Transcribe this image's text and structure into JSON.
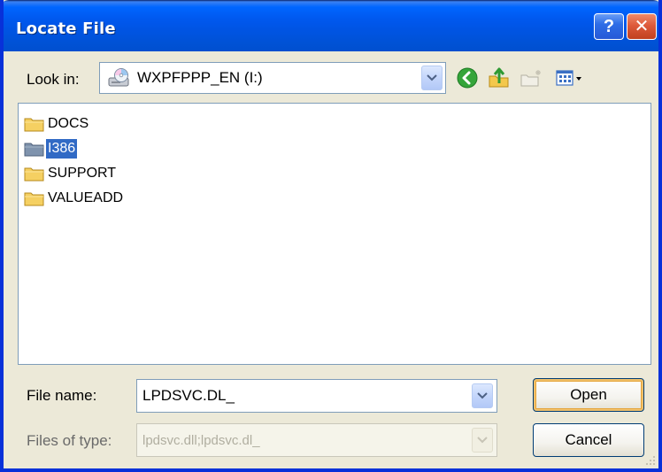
{
  "window": {
    "title": "Locate File",
    "help_glyph": "?",
    "close_glyph": "✕"
  },
  "look_in": {
    "label": "Look in:",
    "value": "WXPFPPP_EN (I:)",
    "icon": "cd-drive-icon"
  },
  "toolbar": {
    "icons": [
      "back-icon",
      "up-folder-icon",
      "new-folder-icon",
      "view-menu-icon"
    ]
  },
  "files": {
    "items": [
      {
        "name": "DOCS",
        "selected": false
      },
      {
        "name": "I386",
        "selected": true
      },
      {
        "name": "SUPPORT",
        "selected": false
      },
      {
        "name": "VALUEADD",
        "selected": false
      }
    ]
  },
  "file_name": {
    "label": "File name:",
    "value": "LPDSVC.DL_"
  },
  "files_of_type": {
    "label": "Files of type:",
    "value": "lpdsvc.dll;lpdsvc.dl_"
  },
  "buttons": {
    "open": "Open",
    "cancel": "Cancel"
  },
  "colors": {
    "title_bar": "#0054e3",
    "dialog_bg": "#ece9d8",
    "selection": "#316ac5",
    "folder": "#f5d062",
    "close_button": "#de5a3b"
  }
}
